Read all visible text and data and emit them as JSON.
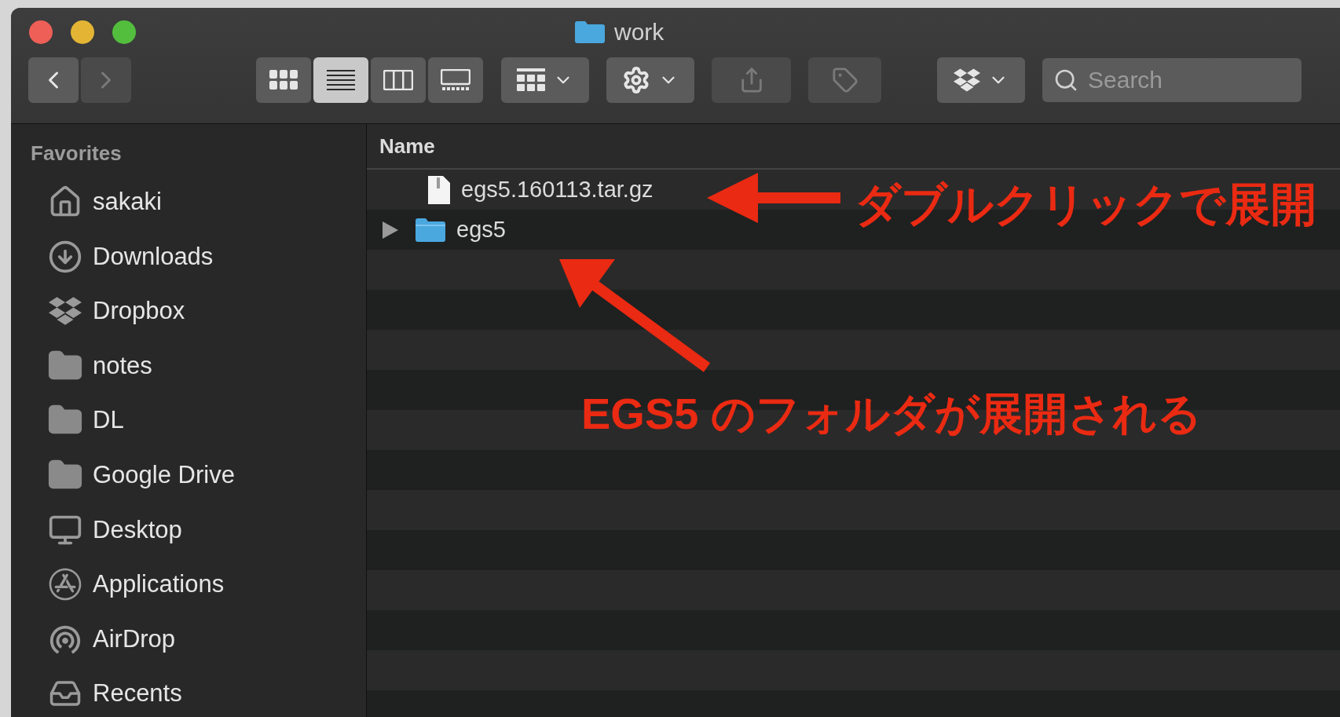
{
  "window": {
    "title": "work"
  },
  "toolbar": {
    "navigation": [
      {
        "kind": "back",
        "disabled": false
      },
      {
        "kind": "forward",
        "disabled": true
      }
    ],
    "view_modes": [
      {
        "kind": "icons",
        "selected": false
      },
      {
        "kind": "list",
        "selected": true
      },
      {
        "kind": "columns",
        "selected": false
      },
      {
        "kind": "gallery",
        "selected": false
      }
    ],
    "buttons": [
      {
        "kind": "group",
        "disabled": false
      },
      {
        "kind": "action",
        "disabled": false
      },
      {
        "kind": "share",
        "disabled": true
      },
      {
        "kind": "tag",
        "disabled": true
      },
      {
        "kind": "dropbox",
        "disabled": false
      }
    ],
    "search": {
      "placeholder": "Search"
    }
  },
  "sidebar": {
    "heading": "Favorites",
    "items": [
      {
        "label": "sakaki",
        "kind": "home"
      },
      {
        "label": "Downloads",
        "kind": "downloads"
      },
      {
        "label": "Dropbox",
        "kind": "dropbox"
      },
      {
        "label": "notes",
        "kind": "folder"
      },
      {
        "label": "DL",
        "kind": "folder"
      },
      {
        "label": "Google Drive",
        "kind": "folder"
      },
      {
        "label": "Desktop",
        "kind": "desktop"
      },
      {
        "label": "Applications",
        "kind": "applications"
      },
      {
        "label": "AirDrop",
        "kind": "airdrop"
      },
      {
        "label": "Recents",
        "kind": "recents"
      }
    ]
  },
  "table": {
    "columns": [
      "Name"
    ],
    "rows": [
      {
        "name": "egs5.160113.tar.gz",
        "kind": "archive"
      },
      {
        "name": "egs5",
        "kind": "folder",
        "expanded": false
      }
    ]
  },
  "annotations": [
    {
      "text": "ダブルクリックで展開"
    },
    {
      "text": "EGS5 のフォルダが展開される"
    }
  ]
}
